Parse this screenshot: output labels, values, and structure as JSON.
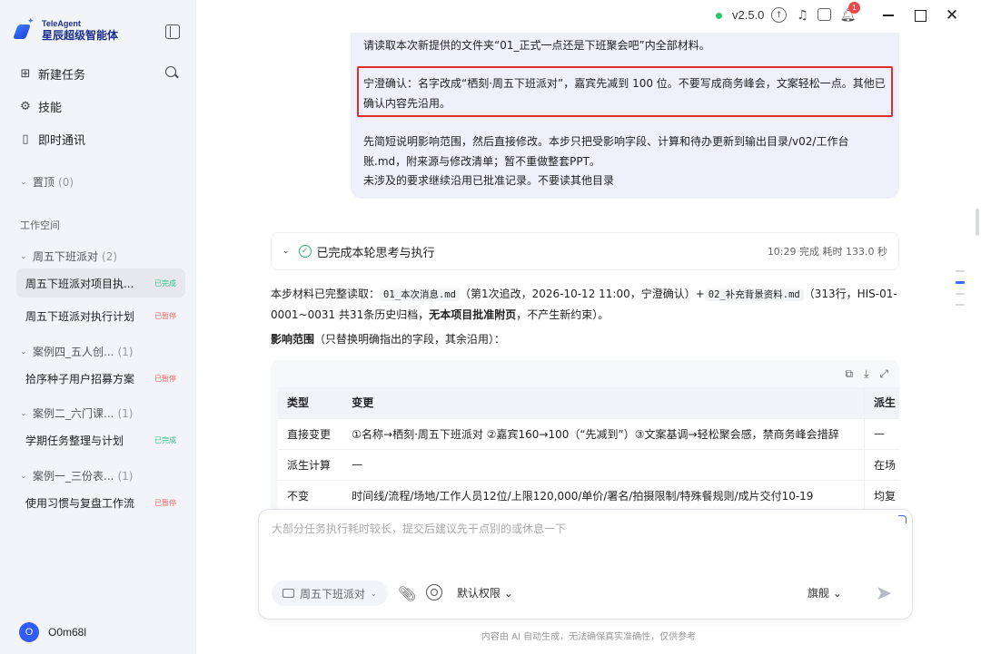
{
  "app": {
    "name_en": "TeleAgent",
    "name_cn": "星辰超级智能体"
  },
  "nav": [
    {
      "label": "新建任务",
      "icon": "new-task-icon"
    },
    {
      "label": "技能",
      "icon": "skill-icon"
    },
    {
      "label": "即时通讯",
      "icon": "chat-icon"
    }
  ],
  "pinned": {
    "label": "置顶",
    "count": "(0)"
  },
  "workspace_label": "工作空间",
  "groups": [
    {
      "label": "周五下班派对",
      "count": "(2)",
      "tasks": [
        {
          "name": "周五下班派对项目执...",
          "status": "已完成"
        },
        {
          "name": "周五下班派对执行计划",
          "status": "已暂停"
        }
      ]
    },
    {
      "label": "案例四_五人创...",
      "count": "(1)",
      "tasks": [
        {
          "name": "拾序种子用户招募方案",
          "status": "已暂停"
        }
      ]
    },
    {
      "label": "案例二_六门课...",
      "count": "(1)",
      "tasks": [
        {
          "name": "学期任务整理与计划",
          "status": "已完成"
        }
      ]
    },
    {
      "label": "案例一_三份表...",
      "count": "(1)",
      "tasks": [
        {
          "name": "使用习惯与复盘工作流",
          "status": "已暂停"
        }
      ]
    }
  ],
  "user": {
    "initial": "O",
    "name": "O0m68l"
  },
  "topbar": {
    "version": "v2.5.0",
    "notifications": "1"
  },
  "message": {
    "p1": "请读取本次新提供的文件夹“01_正式一点还是下班聚会吧”内全部材料。",
    "p2": "宁澄确认：名字改成“栖刻·周五下班派对”，嘉宾先减到 100 位。不要写成商务峰会，文案轻松一点。其他已确认内容先沿用。",
    "p3a": "先简短说明影响范围，然后直接修改。本步只把受影响字段、计算和待办更新到输出目录/v02/工作台账.md，附来源与修改清单；暂不重做整套PPT。",
    "p3b": "未涉及的要求继续沿用已批准记录。不要读其他目录"
  },
  "status": {
    "text": "已完成本轮思考与执行",
    "meta": "10:29 完成 耗时 133.0 秒"
  },
  "summary": {
    "t1": "本步材料已完整读取：",
    "c1": "01_本次消息.md",
    "t2": "（第1次追改，2026-10-12 11:00，宁澄确认）+",
    "c2": "02_补充背景资料.md",
    "t3": "（313行，HIS-01-0001~0031 共31条历史归档，",
    "b1": "无本项目批准附页",
    "t4": "，不产生新约束）。"
  },
  "scope": {
    "title": "影响范围",
    "sub": "（只替换明确指出的字段，其余沿用）："
  },
  "table": {
    "headers": [
      "类型",
      "变更",
      "派生"
    ],
    "rows": [
      [
        "直接变更",
        "①名称→栖刻·周五下班派对 ②嘉宾160→100（“先减到”）③文案基调→轻松聚会感，禁商务峰会措辞",
        "—"
      ],
      [
        "派生计算",
        "—",
        "在场"
      ],
      [
        "不变",
        "时间线/流程/场地/工作人员12位/上限120,000/单价/署名/拍摄限制/特殊餐规则/成片交付10-19",
        "均复"
      ]
    ]
  },
  "composer": {
    "placeholder": "大部分任务执行耗时较长，提交后建议先干点别的或休息一下",
    "folder": "周五下班派对",
    "permission": "默认权限",
    "model": "旗舰"
  },
  "footer": "内容由 AI 自动生成，无法确保真实准确性，仅供参考"
}
